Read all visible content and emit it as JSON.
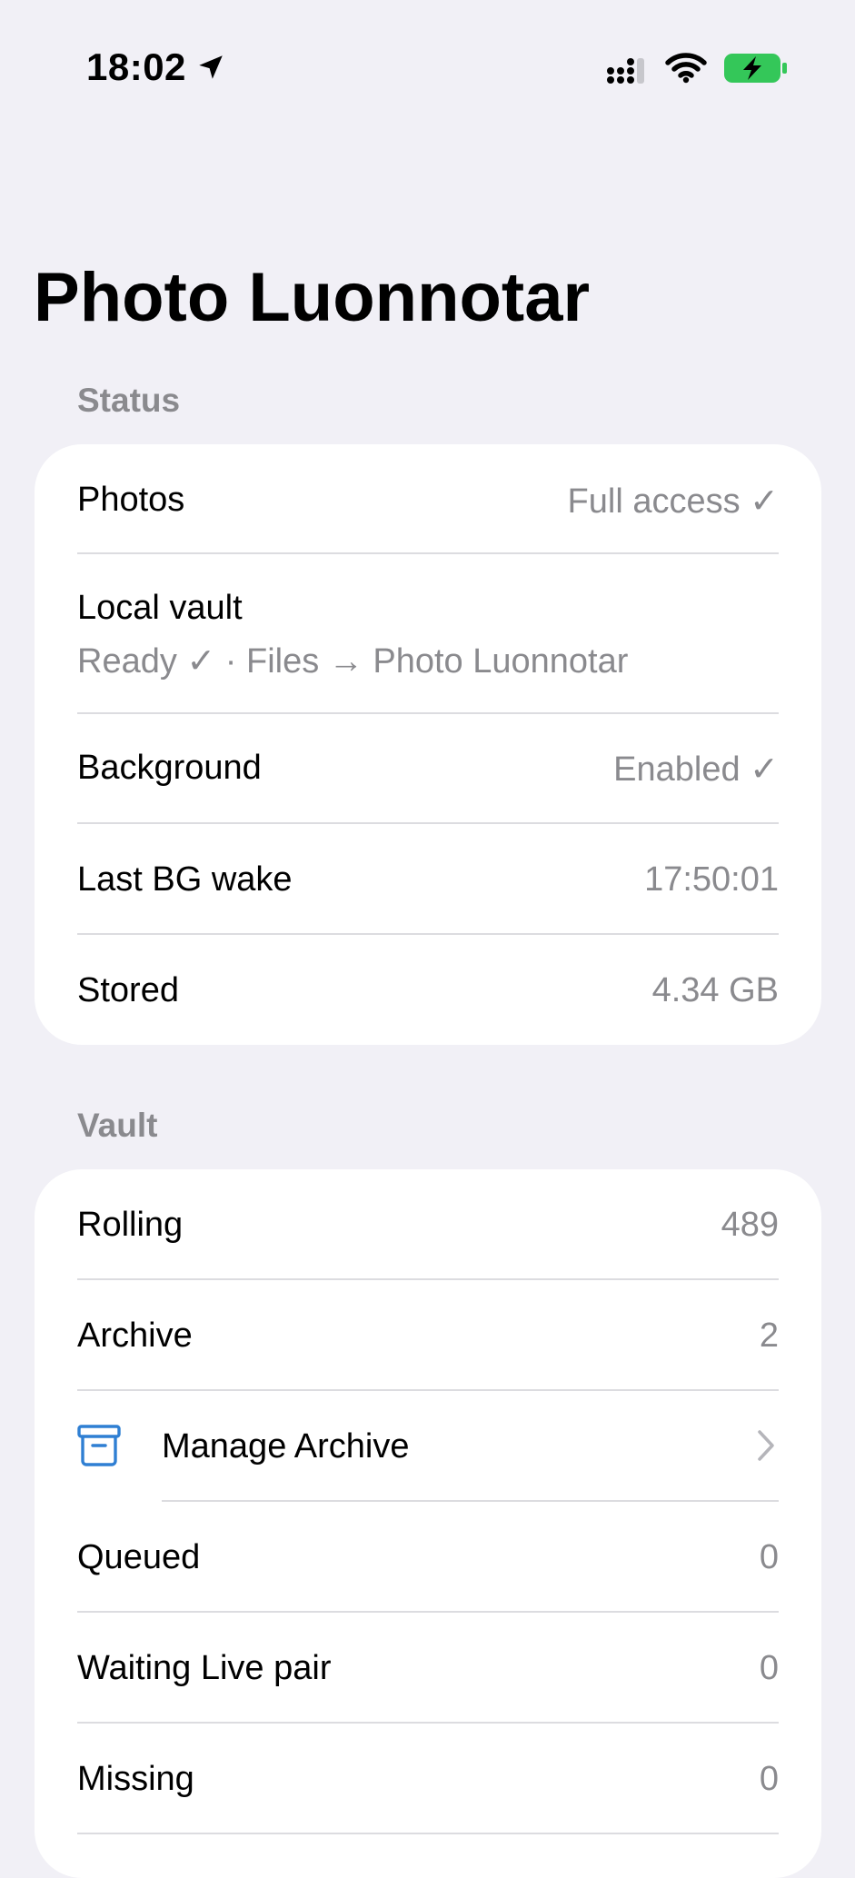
{
  "status_bar": {
    "time": "18:02"
  },
  "title": "Photo Luonnotar",
  "status_section": {
    "header": "Status",
    "photos": {
      "label": "Photos",
      "value": "Full access ✓"
    },
    "local_vault": {
      "label": "Local vault",
      "detail": "Ready ✓ · Files → Photo Luonnotar"
    },
    "background": {
      "label": "Background",
      "value": "Enabled ✓"
    },
    "last_bg_wake": {
      "label": "Last BG wake",
      "value": "17:50:01"
    },
    "stored": {
      "label": "Stored",
      "value": "4.34 GB"
    }
  },
  "vault_section": {
    "header": "Vault",
    "rolling": {
      "label": "Rolling",
      "value": "489"
    },
    "archive": {
      "label": "Archive",
      "value": "2"
    },
    "manage_archive": {
      "label": "Manage Archive"
    },
    "queued": {
      "label": "Queued",
      "value": "0"
    },
    "waiting_live_pair": {
      "label": "Waiting Live pair",
      "value": "0"
    },
    "missing": {
      "label": "Missing",
      "value": "0"
    }
  },
  "colors": {
    "accent": "#2f7fd3",
    "battery": "#34c759",
    "secondary_text": "#8a8a8e",
    "background": "#f1f0f6"
  }
}
